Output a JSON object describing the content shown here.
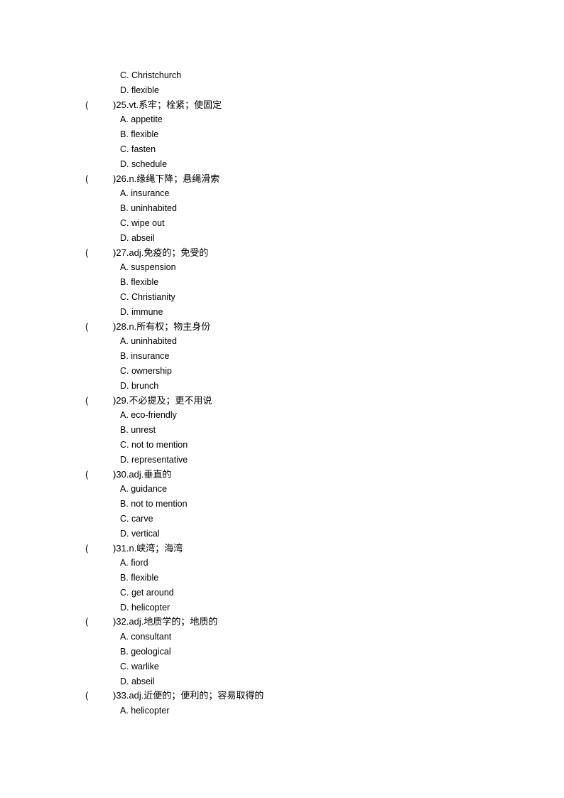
{
  "lead_options": [
    {
      "letter": "C",
      "text": "Christchurch"
    },
    {
      "letter": "D",
      "text": "flexible"
    }
  ],
  "questions": [
    {
      "number": "25",
      "prompt": "vt.系牢；栓紧；使固定",
      "options": [
        {
          "letter": "A",
          "text": "appetite"
        },
        {
          "letter": "B",
          "text": "flexible"
        },
        {
          "letter": "C",
          "text": "fasten"
        },
        {
          "letter": "D",
          "text": "schedule"
        }
      ]
    },
    {
      "number": "26",
      "prompt": "n.缘绳下降；悬绳滑索",
      "options": [
        {
          "letter": "A",
          "text": "insurance"
        },
        {
          "letter": "B",
          "text": "uninhabited"
        },
        {
          "letter": "C",
          "text": "wipe out"
        },
        {
          "letter": "D",
          "text": "abseil"
        }
      ]
    },
    {
      "number": "27",
      "prompt": "adj.免疫的；免受的",
      "options": [
        {
          "letter": "A",
          "text": "suspension"
        },
        {
          "letter": "B",
          "text": "flexible"
        },
        {
          "letter": "C",
          "text": "Christianity"
        },
        {
          "letter": "D",
          "text": "immune"
        }
      ]
    },
    {
      "number": "28",
      "prompt": "n.所有权；物主身份",
      "options": [
        {
          "letter": "A",
          "text": "uninhabited"
        },
        {
          "letter": "B",
          "text": "insurance"
        },
        {
          "letter": "C",
          "text": "ownership"
        },
        {
          "letter": "D",
          "text": "brunch"
        }
      ]
    },
    {
      "number": "29",
      "prompt": "不必提及；更不用说",
      "options": [
        {
          "letter": "A",
          "text": "eco-friendly"
        },
        {
          "letter": "B",
          "text": "unrest"
        },
        {
          "letter": "C",
          "text": "not to mention"
        },
        {
          "letter": "D",
          "text": "representative"
        }
      ]
    },
    {
      "number": "30",
      "prompt": "adj.垂直的",
      "options": [
        {
          "letter": "A",
          "text": "guidance"
        },
        {
          "letter": "B",
          "text": "not to mention"
        },
        {
          "letter": "C",
          "text": "carve"
        },
        {
          "letter": "D",
          "text": "vertical"
        }
      ]
    },
    {
      "number": "31",
      "prompt": "n.峡湾；海湾",
      "options": [
        {
          "letter": "A",
          "text": "fiord"
        },
        {
          "letter": "B",
          "text": "flexible"
        },
        {
          "letter": "C",
          "text": "get around"
        },
        {
          "letter": "D",
          "text": "helicopter"
        }
      ]
    },
    {
      "number": "32",
      "prompt": "adj.地质学的；地质的",
      "options": [
        {
          "letter": "A",
          "text": "consultant"
        },
        {
          "letter": "B",
          "text": "geological"
        },
        {
          "letter": "C",
          "text": "warlike"
        },
        {
          "letter": "D",
          "text": "abseil"
        }
      ]
    },
    {
      "number": "33",
      "prompt": "adj.近便的；便利的；容易取得的",
      "options": [
        {
          "letter": "A",
          "text": "helicopter"
        }
      ]
    }
  ]
}
